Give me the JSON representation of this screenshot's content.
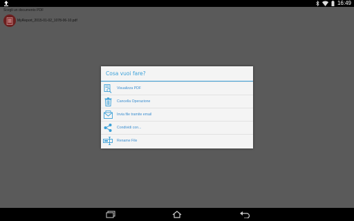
{
  "status_bar": {
    "time": "16:49",
    "icons": [
      "upload-icon",
      "bluetooth-icon",
      "wifi-icon",
      "battery-icon"
    ]
  },
  "app": {
    "header": "Scegli un documento PDF",
    "file_name": "MyReport_2015-01-02_1078-06-10.pdf"
  },
  "dialog": {
    "title": "Cosa vuoi fare?",
    "items": [
      {
        "label": "Visualizza PDF",
        "icon": "view-pdf-icon"
      },
      {
        "label": "Cancella Operazione",
        "icon": "trash-icon"
      },
      {
        "label": "Invia file tramite email",
        "icon": "email-icon"
      },
      {
        "label": "Condividi con...",
        "icon": "share-icon"
      },
      {
        "label": "Rename File",
        "icon": "rename-icon"
      }
    ],
    "accent_color": "#3aa0d8"
  },
  "nav_bar": {
    "icons": [
      "recent-apps-icon",
      "home-icon",
      "back-icon"
    ]
  }
}
